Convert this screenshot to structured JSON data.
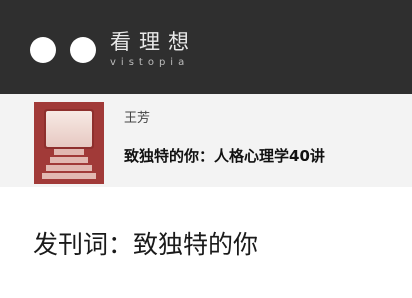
{
  "header": {
    "logo_icon": "two-dots-logo-icon",
    "brand_cn": "看理想",
    "brand_en": "vistopia"
  },
  "course": {
    "cover_icon": "course-cover-image",
    "author": "王芳",
    "title": "致独特的你：人格心理学40讲"
  },
  "article": {
    "title": "发刊词：致独特的你"
  },
  "colors": {
    "header_bg": "#2f2f2f",
    "card_bg": "#f3f3f3",
    "cover_red": "#a13a38"
  }
}
